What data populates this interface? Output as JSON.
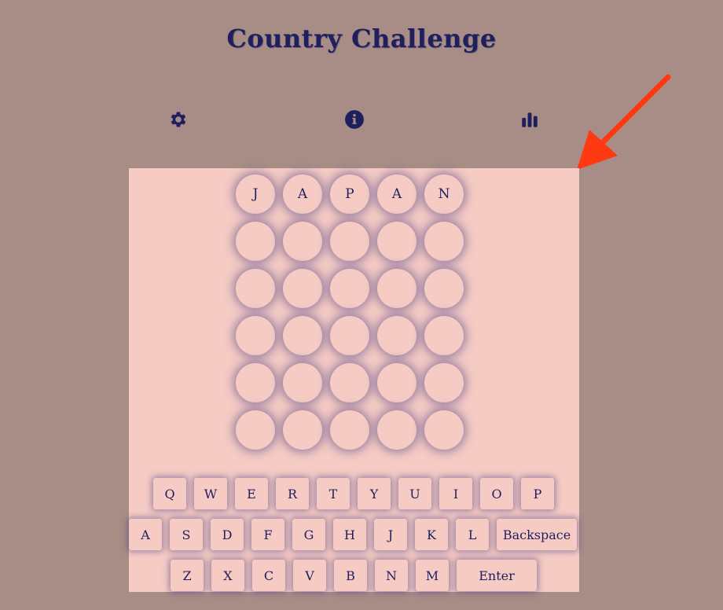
{
  "header": {
    "title": "Country Challenge"
  },
  "toolbar": {
    "settings_icon": "gear-icon",
    "info_icon": "info-icon",
    "stats_icon": "bar-chart-icon"
  },
  "colors": {
    "page_background": "#a88c86",
    "panel_background": "#f5cbc4",
    "text_primary": "#1f1f5e",
    "annotation_arrow": "#ff3a12"
  },
  "board": {
    "rows": [
      [
        "J",
        "A",
        "P",
        "A",
        "N"
      ],
      [
        "",
        "",
        "",
        "",
        ""
      ],
      [
        "",
        "",
        "",
        "",
        ""
      ],
      [
        "",
        "",
        "",
        "",
        ""
      ],
      [
        "",
        "",
        "",
        "",
        ""
      ],
      [
        "",
        "",
        "",
        "",
        ""
      ]
    ]
  },
  "keyboard": {
    "row1": [
      "Q",
      "W",
      "E",
      "R",
      "T",
      "Y",
      "U",
      "I",
      "O",
      "P"
    ],
    "row2": [
      "A",
      "S",
      "D",
      "F",
      "G",
      "H",
      "J",
      "K",
      "L",
      "Backspace"
    ],
    "row3": [
      "Z",
      "X",
      "C",
      "V",
      "B",
      "N",
      "M",
      "Enter"
    ]
  }
}
